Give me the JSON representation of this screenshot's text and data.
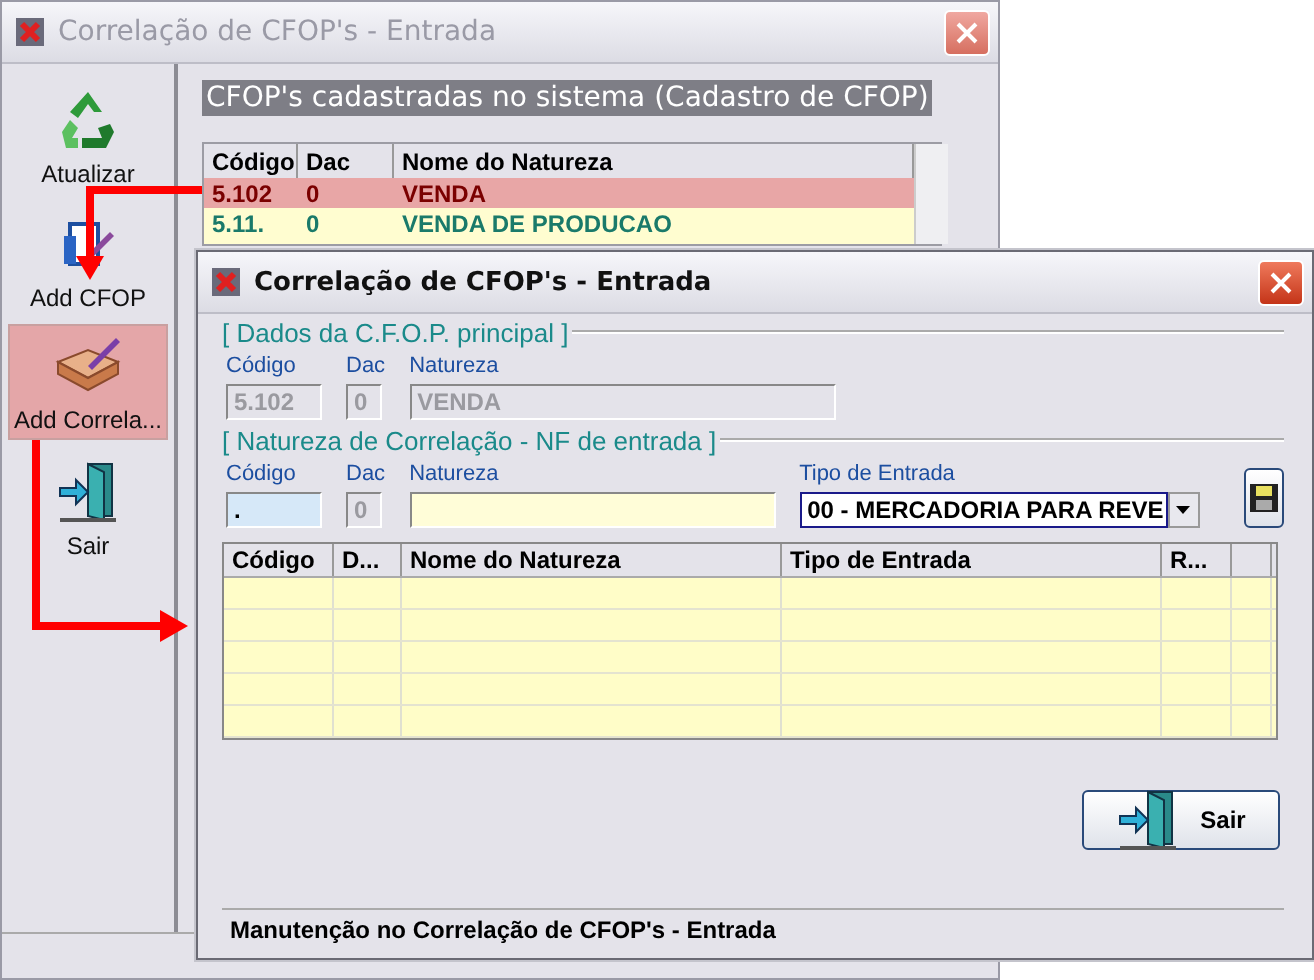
{
  "main_window": {
    "title": "Correlação de CFOP's - Entrada",
    "toolbar": [
      {
        "label": "Atualizar",
        "kind": "refresh",
        "selected": false
      },
      {
        "label": "Add CFOP",
        "kind": "add",
        "selected": false
      },
      {
        "label": "Add Correla...",
        "kind": "correlate",
        "selected": true
      },
      {
        "label": "Sair",
        "kind": "exit",
        "selected": false
      }
    ],
    "heading": "CFOP's cadastradas no sistema (Cadastro de CFOP)",
    "table": {
      "columns": [
        "Código",
        "Dac",
        "Nome do Natureza"
      ],
      "rows": [
        {
          "cells": [
            "5.102",
            "0",
            "VENDA"
          ],
          "selected": true
        },
        {
          "cells": [
            "5.11.",
            "0",
            "VENDA DE PRODUCAO"
          ],
          "selected": false
        }
      ]
    }
  },
  "dialog": {
    "title": "Correlação de CFOP's - Entrada",
    "groups": [
      {
        "legend": "[ Dados da C.F.O.P. principal ]",
        "fields": [
          {
            "label": "Código",
            "value": "5.102",
            "kind": "code",
            "disabled": true,
            "focused": false
          },
          {
            "label": "Dac",
            "value": "0",
            "kind": "dac",
            "disabled": true,
            "focused": false
          },
          {
            "label": "Natureza",
            "value": "VENDA",
            "kind": "name",
            "disabled": true,
            "focused": false
          }
        ]
      },
      {
        "legend": "[ Natureza de Correlação - NF de entrada ]",
        "fields": [
          {
            "label": "Código",
            "value": ".",
            "kind": "code",
            "disabled": false,
            "focused": true
          },
          {
            "label": "Dac",
            "value": "0",
            "kind": "dac",
            "disabled": true,
            "focused": false
          },
          {
            "label": "Natureza",
            "kind": "name2",
            "disabled": false,
            "focused": false
          },
          {
            "label": "Tipo de Entrada",
            "value": "00 - MERCADORIA PARA REVE",
            "kind": "combo",
            "disabled": false,
            "focused": false
          }
        ]
      }
    ],
    "grid": {
      "columns": [
        "Código",
        "D...",
        "Nome do Natureza",
        "Tipo de Entrada",
        "R..."
      ]
    },
    "button": "Sair",
    "status_bar": "Manutenção no Correlação de CFOP's - Entrada"
  }
}
